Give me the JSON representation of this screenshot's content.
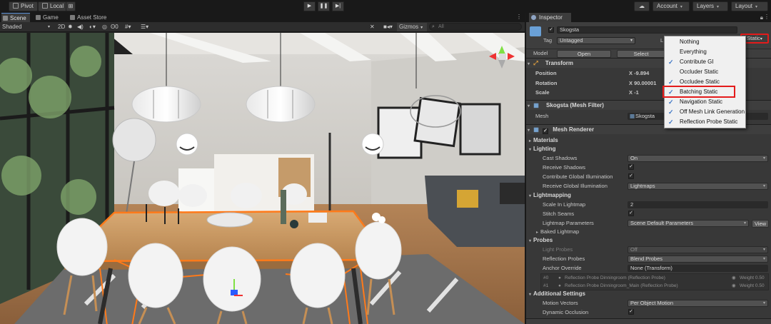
{
  "toolbar": {
    "pivot": "Pivot",
    "local": "Local",
    "account": "Account",
    "layers": "Layers",
    "layout": "Layout"
  },
  "scene": {
    "tabs": [
      {
        "label": "Scene",
        "icon": "grid-icon"
      },
      {
        "label": "Game",
        "icon": "gamepad-icon"
      },
      {
        "label": "Asset Store",
        "icon": "store-icon"
      }
    ],
    "shading": "Shaded",
    "mode_2d": "2D",
    "fx_count": "0",
    "gizmos": "Gizmos",
    "search_placeholder": "All"
  },
  "inspector": {
    "tab": "Inspector",
    "object_name": "Skogsta",
    "tag_label": "Tag",
    "tag_value": "Untagged",
    "layer_label": "L",
    "model_label": "Model",
    "open_button": "Open",
    "select_button": "Select",
    "static_button": "Static",
    "transform": {
      "title": "Transform",
      "position_label": "Position",
      "position_x": "X -9.894",
      "rotation_label": "Rotation",
      "rotation_x": "X 90.00001",
      "scale_label": "Scale",
      "scale_x": "X -1"
    },
    "mesh_filter": {
      "title": "Skogsta (Mesh Filter)",
      "mesh_label": "Mesh",
      "mesh_value": "Skogsta"
    },
    "mesh_renderer": {
      "title": "Mesh Renderer",
      "materials": "Materials",
      "lighting": "Lighting",
      "cast_shadows_label": "Cast Shadows",
      "cast_shadows_value": "On",
      "receive_shadows_label": "Receive Shadows",
      "contribute_gi_label": "Contribute Global Illumination",
      "receive_gi_label": "Receive Global Illumination",
      "receive_gi_value": "Lightmaps",
      "lightmapping": "Lightmapping",
      "scale_lightmap_label": "Scale In Lightmap",
      "scale_lightmap_value": "2",
      "stitch_seams_label": "Stitch Seams",
      "lightmap_params_label": "Lightmap Parameters",
      "lightmap_params_value": "Scene Default Parameters",
      "view_button": "View",
      "baked_lightmap": "Baked Lightmap",
      "probes": "Probes",
      "light_probes_label": "Light Probes",
      "light_probes_value": "Off",
      "reflection_probes_label": "Reflection Probes",
      "reflection_probes_value": "Blend Probes",
      "anchor_override_label": "Anchor Override",
      "anchor_override_value": "None (Transform)",
      "probe_list": [
        {
          "index": "#0",
          "name": "Reflection Probe Dinningroom (Reflection Probe)",
          "weight": "Weight 0.50"
        },
        {
          "index": "#1",
          "name": "Reflection Probe Dinningroom_Main (Reflection Probe)",
          "weight": "Weight 0.50"
        }
      ],
      "additional_settings": "Additional Settings",
      "motion_vectors_label": "Motion Vectors",
      "motion_vectors_value": "Per Object Motion",
      "dynamic_occlusion_label": "Dynamic Occlusion"
    }
  },
  "static_menu": {
    "items": [
      {
        "label": "Nothing",
        "checked": false
      },
      {
        "label": "Everything",
        "checked": false
      },
      {
        "label": "Contribute GI",
        "checked": true
      },
      {
        "label": "Occluder Static",
        "checked": false
      },
      {
        "label": "Occludee Static",
        "checked": true
      },
      {
        "label": "Batching Static",
        "checked": true
      },
      {
        "label": "Navigation Static",
        "checked": true
      },
      {
        "label": "Off Mesh Link Generation",
        "checked": true
      },
      {
        "label": "Reflection Probe Static",
        "checked": true
      }
    ]
  },
  "colors": {
    "highlight": "#e41b1b",
    "selection_outline": "#ff7a1a",
    "check": "#3d76c6"
  }
}
